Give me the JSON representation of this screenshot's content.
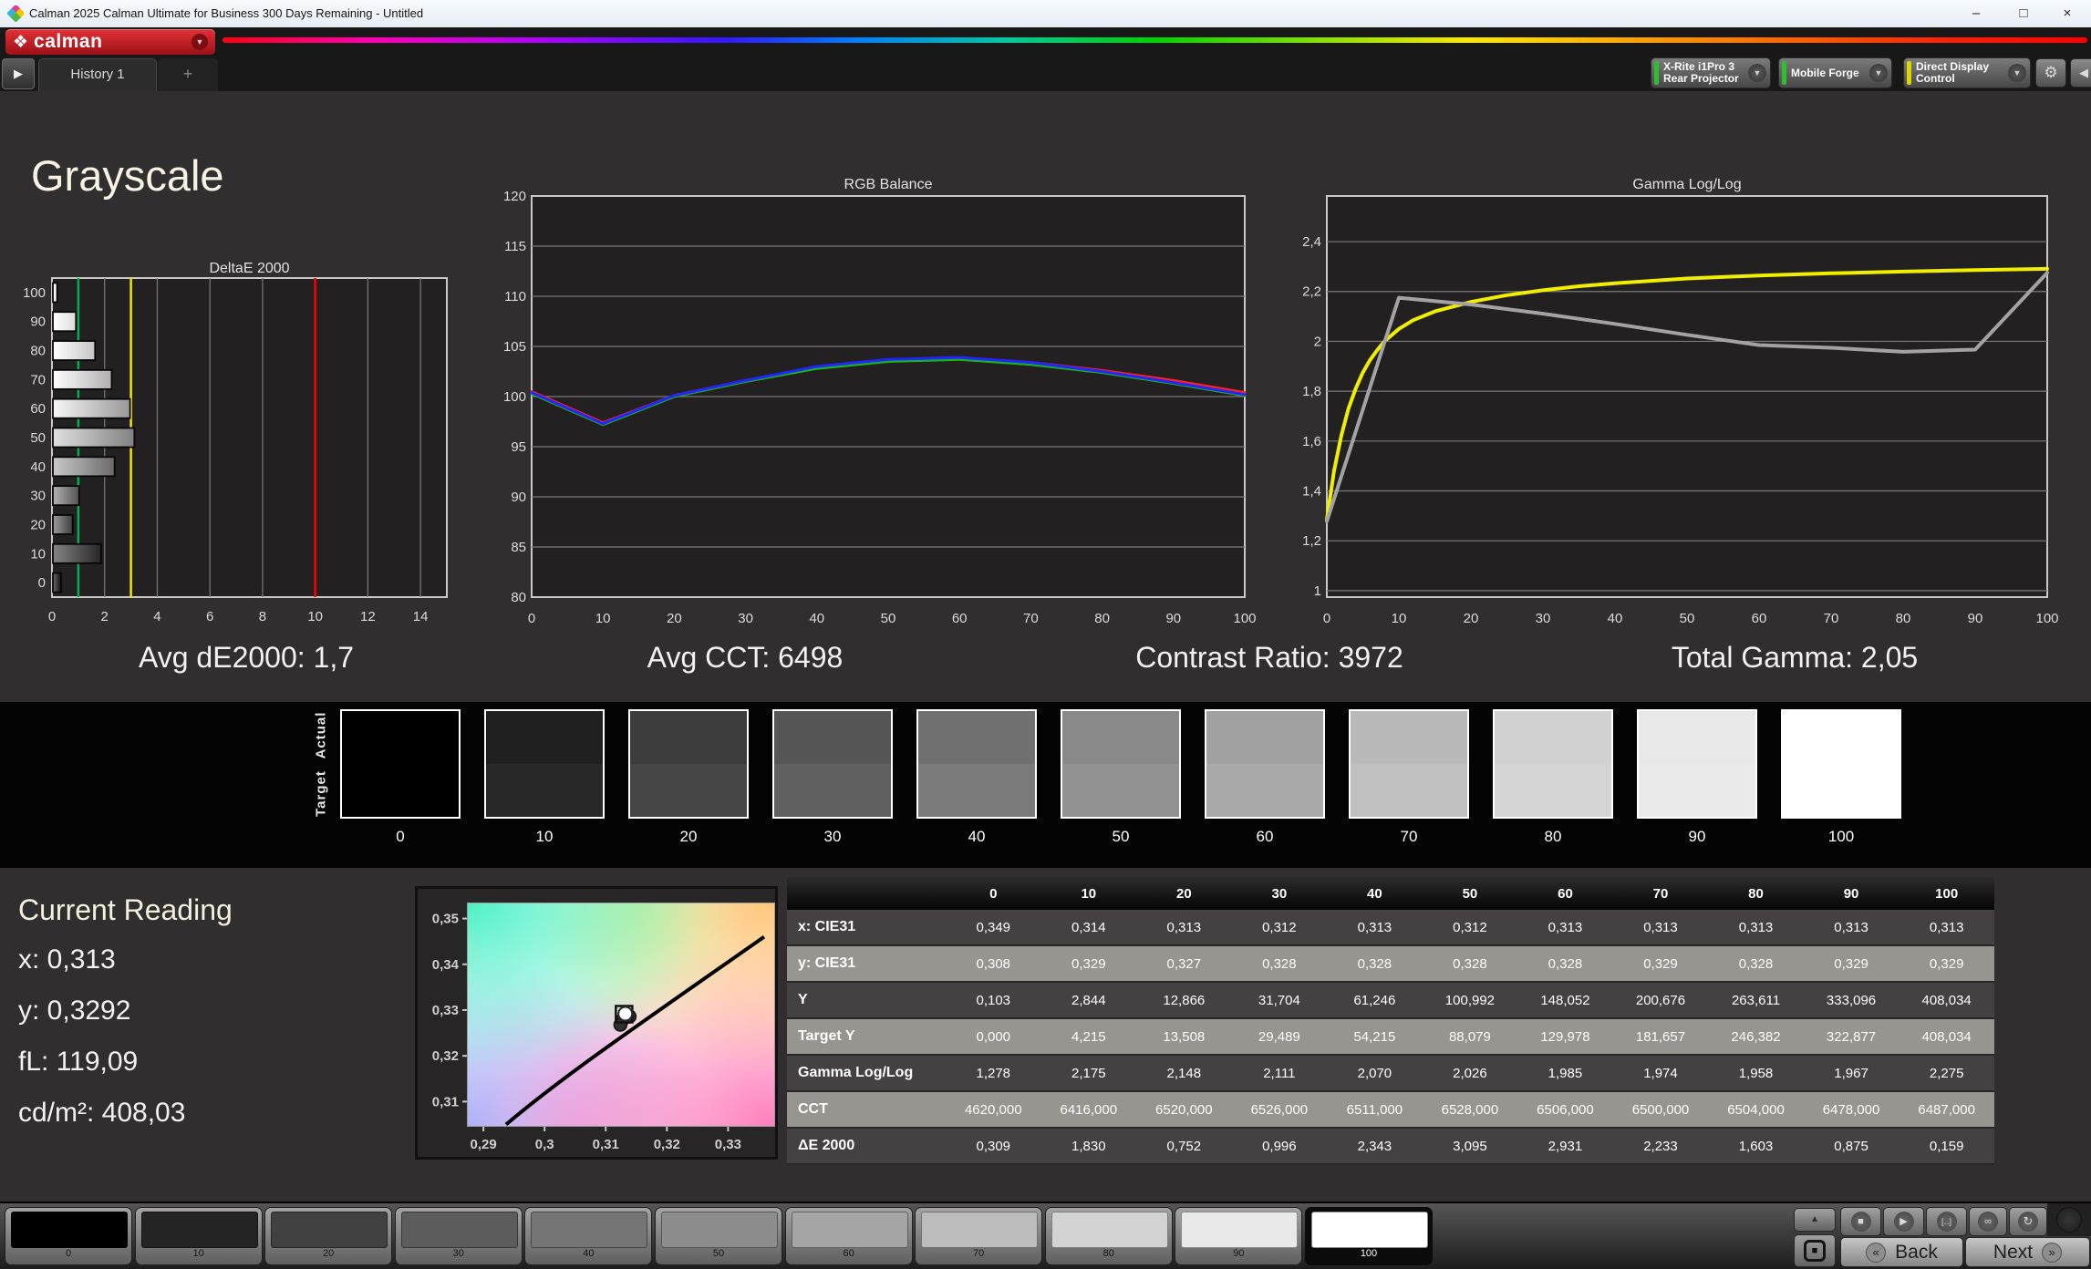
{
  "window": {
    "title": "Calman 2025 Calman Ultimate for Business 300 Days Remaining  - Untitled",
    "minimize": "–",
    "maximize": "□",
    "close": "×"
  },
  "toolbar": {
    "logo_text": "calman",
    "logo_glyph": "❖",
    "chevron": "▼",
    "history_tab": "History 1",
    "add_tab": "+",
    "expander_glyph": "▶",
    "gear_glyph": "⚙",
    "collapse_glyph": "◀",
    "meters": [
      {
        "line1": "X-Rite i1Pro 3",
        "line2": "Rear Projector",
        "stripe": "#2ebf2e"
      },
      {
        "line1": "Mobile Forge",
        "stripe": "#2ebf2e"
      },
      {
        "line1": "Direct Display Control",
        "stripe": "#ddd400"
      }
    ]
  },
  "page": {
    "title": "Grayscale"
  },
  "summary": {
    "avg_de2000": "Avg dE2000: 1,7",
    "avg_cct": "Avg CCT: 6498",
    "contrast_ratio": "Contrast Ratio: 3972",
    "total_gamma": "Total Gamma: 2,05"
  },
  "chart_data": [
    {
      "type": "bar",
      "orientation": "horizontal",
      "title": "DeltaE 2000",
      "categories": [
        100,
        90,
        80,
        70,
        60,
        50,
        40,
        30,
        20,
        10,
        0
      ],
      "values": [
        0.159,
        0.875,
        1.603,
        2.233,
        2.931,
        3.095,
        2.343,
        0.996,
        0.752,
        1.83,
        0.309
      ],
      "xlim": [
        0,
        15
      ],
      "xticks": [
        0,
        2,
        4,
        6,
        8,
        10,
        12,
        14
      ],
      "ref_lines": [
        {
          "x": 1,
          "color": "#00b050"
        },
        {
          "x": 3,
          "color": "#f5e400"
        },
        {
          "x": 10,
          "color": "#ff0000"
        }
      ]
    },
    {
      "type": "line",
      "title": "RGB Balance",
      "x": [
        0,
        10,
        20,
        30,
        40,
        50,
        60,
        70,
        80,
        90,
        100
      ],
      "ylim": [
        80,
        120
      ],
      "yticks": [
        80,
        85,
        90,
        95,
        100,
        105,
        110,
        115,
        120
      ],
      "series": [
        {
          "name": "Red",
          "color": "#ff2020",
          "values": [
            100.5,
            97.4,
            100.1,
            101.6,
            102.9,
            103.6,
            103.8,
            103.4,
            102.6,
            101.6,
            100.4
          ]
        },
        {
          "name": "Green",
          "color": "#17b517",
          "values": [
            100.3,
            97.2,
            100.0,
            101.5,
            102.8,
            103.5,
            103.7,
            103.2,
            102.4,
            101.3,
            100.1
          ]
        },
        {
          "name": "Blue",
          "color": "#2424ff",
          "values": [
            100.4,
            97.3,
            100.1,
            101.6,
            103.0,
            103.7,
            103.9,
            103.4,
            102.5,
            101.4,
            100.2
          ]
        }
      ]
    },
    {
      "type": "line",
      "title": "Gamma Log/Log",
      "x": [
        0,
        10,
        20,
        30,
        40,
        50,
        60,
        70,
        80,
        90,
        100
      ],
      "ylim": [
        0.974,
        2.583
      ],
      "yticks": [
        1,
        1.2,
        1.4,
        1.6,
        1.8,
        2,
        2.2,
        2.4
      ],
      "ytick_labels": [
        "1",
        "1,2",
        "1,4",
        "1,6",
        "1,8",
        "2",
        "2,2",
        "2,4"
      ],
      "series": [
        {
          "name": "Target",
          "color": "#f2ee00",
          "points": [
            [
              0,
              1.285
            ],
            [
              1,
              1.48
            ],
            [
              2,
              1.62
            ],
            [
              3,
              1.73
            ],
            [
              4,
              1.81
            ],
            [
              5,
              1.875
            ],
            [
              6,
              1.925
            ],
            [
              7,
              1.965
            ],
            [
              8,
              2.0
            ],
            [
              10,
              2.05
            ],
            [
              12,
              2.085
            ],
            [
              15,
              2.12
            ],
            [
              20,
              2.158
            ],
            [
              25,
              2.185
            ],
            [
              30,
              2.205
            ],
            [
              35,
              2.221
            ],
            [
              40,
              2.233
            ],
            [
              50,
              2.252
            ],
            [
              60,
              2.264
            ],
            [
              70,
              2.273
            ],
            [
              80,
              2.28
            ],
            [
              90,
              2.286
            ],
            [
              100,
              2.291
            ]
          ]
        },
        {
          "name": "Measured",
          "color": "#a3a3a3",
          "values": [
            1.278,
            2.175,
            2.148,
            2.111,
            2.07,
            2.026,
            1.985,
            1.974,
            1.958,
            1.967,
            2.275
          ]
        }
      ]
    },
    {
      "type": "scatter",
      "title": "CIE xy",
      "xlim": [
        0.2873,
        0.3377
      ],
      "ylim": [
        0.3045,
        0.3535
      ],
      "xticks": [
        0.29,
        0.3,
        0.31,
        0.32,
        0.33
      ],
      "xtick_labels": [
        "0,29",
        "0,3",
        "0,31",
        "0,32",
        "0,33"
      ],
      "yticks": [
        0.31,
        0.32,
        0.33,
        0.34,
        0.35
      ],
      "ytick_labels": [
        "0,31",
        "0,32",
        "0,33",
        "0,34",
        "0,35"
      ],
      "locus": [
        [
          0.2937,
          0.305
        ],
        [
          0.303,
          0.3155
        ],
        [
          0.314,
          0.3255
        ],
        [
          0.3359,
          0.346
        ]
      ],
      "points": [
        {
          "x": 0.3139,
          "y": 0.3286,
          "kind": "measured"
        },
        {
          "x": 0.3127,
          "y": 0.3278,
          "kind": "measured"
        },
        {
          "x": 0.3124,
          "y": 0.3268,
          "kind": "measured"
        },
        {
          "x": 0.313,
          "y": 0.3291,
          "kind": "target-square"
        },
        {
          "x": 0.3132,
          "y": 0.3292,
          "kind": "current"
        }
      ]
    }
  ],
  "swatches": {
    "actual_label": "Actual",
    "target_label": "Target",
    "levels": [
      0,
      10,
      20,
      30,
      40,
      50,
      60,
      70,
      80,
      90,
      100
    ]
  },
  "current_reading": {
    "title": "Current Reading",
    "x": "x: 0,313",
    "y": "y: 0,3292",
    "fl": "fL: 119,09",
    "cdm2": "cd/m²: 408,03"
  },
  "table": {
    "columns": [
      "0",
      "10",
      "20",
      "30",
      "40",
      "50",
      "60",
      "70",
      "80",
      "90",
      "100"
    ],
    "rows": [
      {
        "label": "x: CIE31",
        "shade": "dark",
        "values": [
          "0,349",
          "0,314",
          "0,313",
          "0,312",
          "0,313",
          "0,312",
          "0,313",
          "0,313",
          "0,313",
          "0,313",
          "0,313"
        ]
      },
      {
        "label": "y: CIE31",
        "shade": "light",
        "values": [
          "0,308",
          "0,329",
          "0,327",
          "0,328",
          "0,328",
          "0,328",
          "0,328",
          "0,329",
          "0,328",
          "0,329",
          "0,329"
        ]
      },
      {
        "label": "Y",
        "shade": "dark",
        "values": [
          "0,103",
          "2,844",
          "12,866",
          "31,704",
          "61,246",
          "100,992",
          "148,052",
          "200,676",
          "263,611",
          "333,096",
          "408,034"
        ]
      },
      {
        "label": "Target Y",
        "shade": "light",
        "values": [
          "0,000",
          "4,215",
          "13,508",
          "29,489",
          "54,215",
          "88,079",
          "129,978",
          "181,657",
          "246,382",
          "322,877",
          "408,034"
        ]
      },
      {
        "label": "Gamma Log/Log",
        "shade": "dark",
        "values": [
          "1,278",
          "2,175",
          "2,148",
          "2,111",
          "2,070",
          "2,026",
          "1,985",
          "1,974",
          "1,958",
          "1,967",
          "2,275"
        ]
      },
      {
        "label": "CCT",
        "shade": "light",
        "values": [
          "4620,000",
          "6416,000",
          "6520,000",
          "6526,000",
          "6511,000",
          "6528,000",
          "6506,000",
          "6500,000",
          "6504,000",
          "6478,000",
          "6487,000"
        ]
      },
      {
        "label": "ΔE 2000",
        "shade": "dark",
        "values": [
          "0,309",
          "1,830",
          "0,752",
          "0,996",
          "2,343",
          "3,095",
          "2,931",
          "2,233",
          "1,603",
          "0,875",
          "0,159"
        ]
      }
    ]
  },
  "bottom": {
    "levels": [
      0,
      10,
      20,
      30,
      40,
      50,
      60,
      70,
      80,
      90,
      100
    ],
    "selected": 100,
    "back_label": "Back",
    "next_label": "Next",
    "back_chev": "«",
    "next_chev": "»",
    "icons": {
      "up": "▲",
      "stop": "■",
      "play": "▶",
      "step": "[‥]",
      "loop": "∞",
      "refresh": "↻",
      "window": "■"
    }
  }
}
